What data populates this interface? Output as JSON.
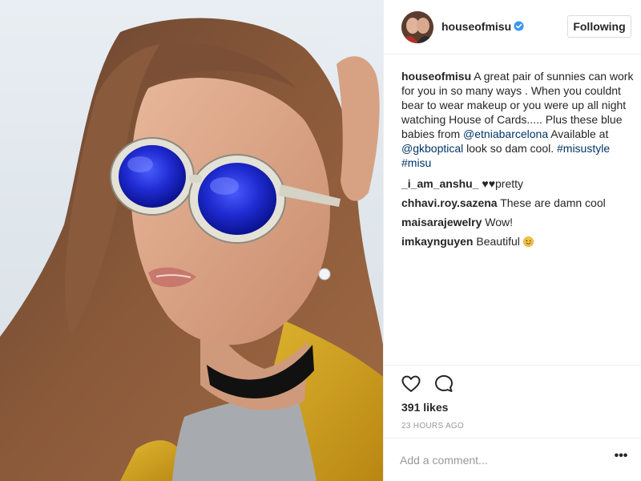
{
  "post": {
    "image_alt": "Woman wearing round blue mirrored sunglasses and a black choker",
    "author": {
      "username": "houseofmisu",
      "verified": true,
      "follow_label": "Following"
    },
    "caption": {
      "username": "houseofmisu",
      "text_1": " A great pair of sunnies can work for you in so many ways . When you couldnt bear to wear makeup or you were up all night watching House of Cards..... Plus these blue babies from ",
      "mention_1": "@etniabarcelona",
      "text_2": " Available at ",
      "mention_2": "@gkboptical",
      "text_3": " look so dam cool. ",
      "hashtag_1": "#misustyle",
      "text_4": " ",
      "hashtag_2": "#misu"
    },
    "comments": [
      {
        "username": "_i_am_anshu_",
        "text": " ♥♥pretty"
      },
      {
        "username": "chhavi.roy.sazena",
        "text": " These are damn cool"
      },
      {
        "username": "maisarajewelry",
        "text": " Wow!"
      },
      {
        "username": "imkaynguyen",
        "text": " Beautiful ",
        "emoji": "smiling-face-emoji"
      }
    ],
    "likes": "391 likes",
    "time_ago": "23 HOURS AGO",
    "comment_placeholder": "Add a comment...",
    "more_label": "•••",
    "icons": {
      "like": "heart-icon",
      "comment": "speech-bubble-icon",
      "more": "more-options-icon",
      "verified": "verified-badge-icon"
    },
    "colors": {
      "link": "#003569",
      "verified": "#3897f0",
      "muted": "#999999",
      "border": "#efefef",
      "text": "#262626"
    }
  }
}
